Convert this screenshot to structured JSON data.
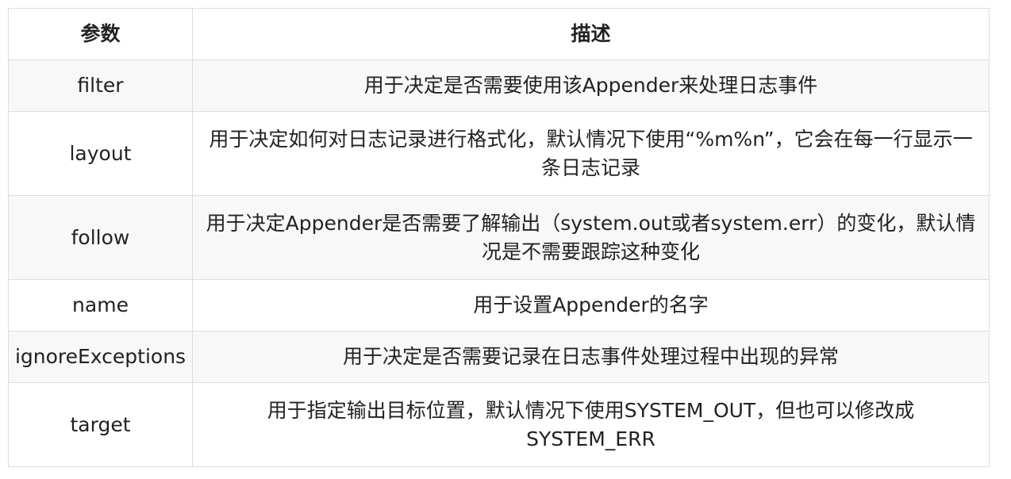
{
  "table": {
    "headers": [
      "参数",
      "描述"
    ],
    "rows": [
      {
        "param": "filter",
        "desc": "用于决定是否需要使用该Appender来处理日志事件"
      },
      {
        "param": "layout",
        "desc": "用于决定如何对日志记录进行格式化，默认情况下使用“%m%n”，它会在每一行显示一条日志记录"
      },
      {
        "param": "follow",
        "desc": "用于决定Appender是否需要了解输出（system.out或者system.err）的变化，默认情况是不需要跟踪这种变化"
      },
      {
        "param": "name",
        "desc": "用于设置Appender的名字"
      },
      {
        "param": "ignoreExceptions",
        "desc": "用于决定是否需要记录在日志事件处理过程中出现的异常"
      },
      {
        "param": "target",
        "desc": "用于指定输出目标位置，默认情况下使用SYSTEM_OUT，但也可以修改成SYSTEM_ERR"
      }
    ]
  }
}
